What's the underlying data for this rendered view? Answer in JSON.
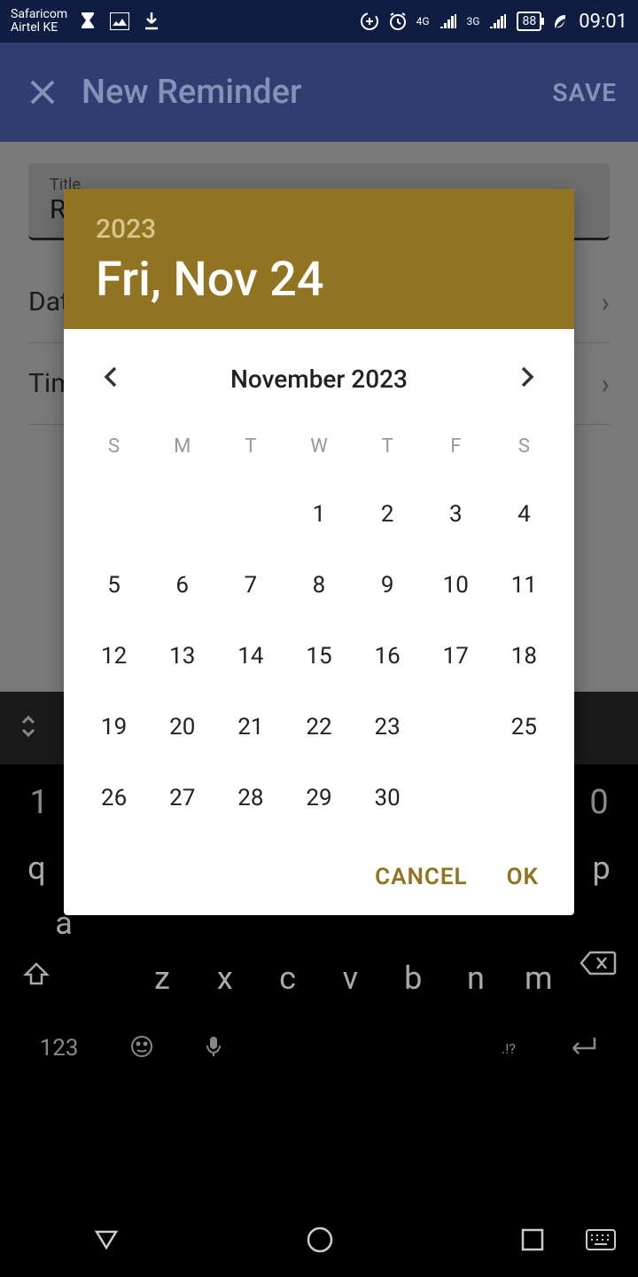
{
  "status_bar": {
    "carrier_line1": "Safaricom",
    "carrier_line2": "Airtel KE",
    "battery_pct": "88",
    "time": "09:01",
    "net1": "4G",
    "net2": "3G"
  },
  "app_bar": {
    "title": "New Reminder",
    "save": "SAVE"
  },
  "form": {
    "title_label": "Title",
    "title_value": "R",
    "date_label": "Date",
    "time_label": "Time"
  },
  "date_picker": {
    "year": "2023",
    "date_display": "Fri, Nov 24",
    "month_year": "November 2023",
    "days_of_week": [
      "S",
      "M",
      "T",
      "W",
      "T",
      "F",
      "S"
    ],
    "leading_blanks": 3,
    "days_in_month": 30,
    "selected_day": 24,
    "cancel": "CANCEL",
    "ok": "OK"
  },
  "keyboard": {
    "num_left": "1",
    "num_right": "0",
    "row_q": [
      "q",
      "",
      "",
      "",
      "",
      "",
      "",
      "",
      "",
      "p"
    ],
    "row_a": [
      "a",
      "",
      "",
      "",
      "",
      "",
      "",
      "",
      ""
    ],
    "row_z": [
      "",
      "z",
      "x",
      "c",
      "v",
      "b",
      "n",
      "m",
      ""
    ],
    "sym_key": "123",
    "punct": ".!?"
  }
}
